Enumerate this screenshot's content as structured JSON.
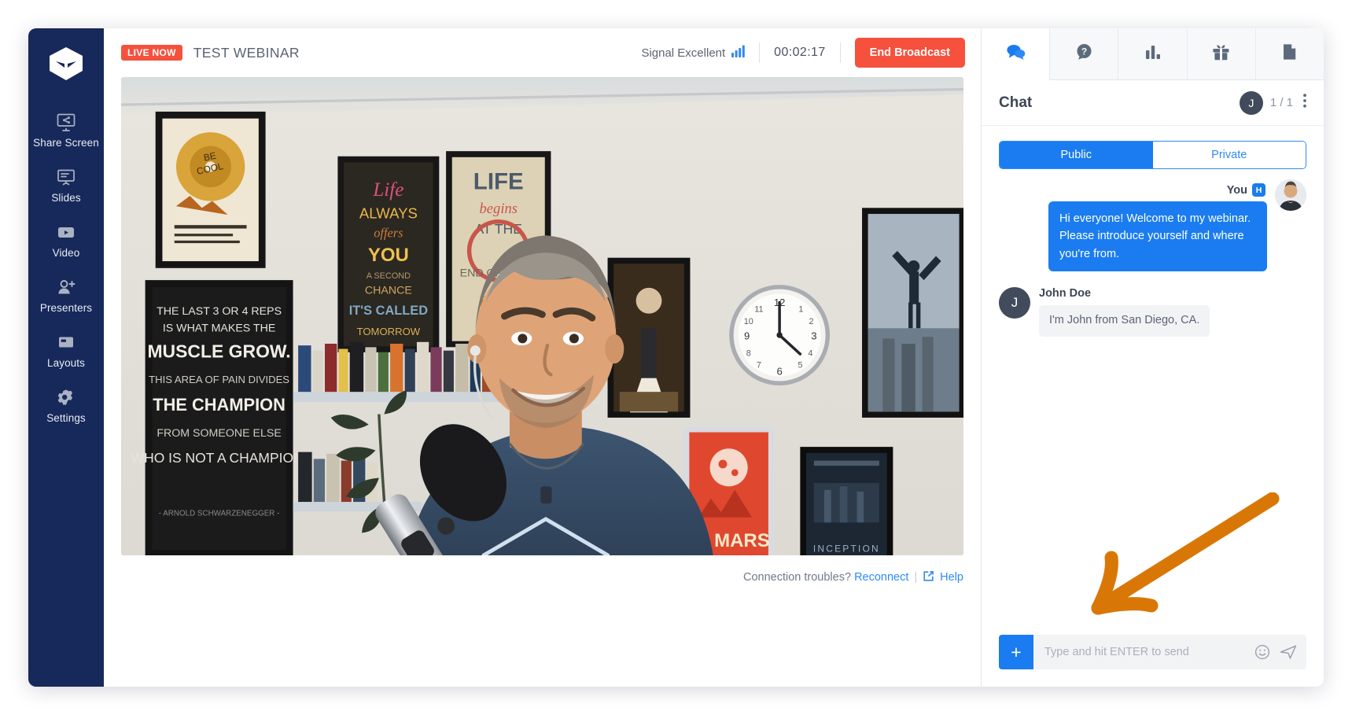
{
  "sidebar": {
    "logo_name": "webinarninja-logo",
    "items": [
      {
        "label": "Share Screen",
        "icon": "share-screen-icon"
      },
      {
        "label": "Slides",
        "icon": "slides-icon"
      },
      {
        "label": "Video",
        "icon": "video-icon"
      },
      {
        "label": "Presenters",
        "icon": "presenters-icon"
      },
      {
        "label": "Layouts",
        "icon": "layouts-icon"
      },
      {
        "label": "Settings",
        "icon": "settings-icon"
      }
    ]
  },
  "header": {
    "live_badge": "LIVE NOW",
    "title": "TEST WEBINAR",
    "signal_label": "Signal Excellent",
    "signal_icon": "signal-bars-icon",
    "timer": "00:02:17",
    "end_broadcast_label": "End Broadcast",
    "live_color": "#f5513d"
  },
  "stage": {
    "connection": {
      "prompt": "Connection troubles?",
      "reconnect_label": "Reconnect",
      "separator": "|",
      "help_label": "Help",
      "external_icon": "external-link-icon"
    }
  },
  "panel": {
    "tabs": [
      {
        "name": "chat",
        "icon": "chat-bubble-icon",
        "active": true
      },
      {
        "name": "questions",
        "icon": "question-bubble-icon",
        "active": false
      },
      {
        "name": "polls",
        "icon": "bar-chart-icon",
        "active": false
      },
      {
        "name": "offers",
        "icon": "gift-icon",
        "active": false
      },
      {
        "name": "handouts",
        "icon": "file-icon",
        "active": false
      }
    ],
    "chat_title": "Chat",
    "viewer_avatar_initial": "J",
    "viewer_count": "1 / 1",
    "menu_icon": "kebab-menu-icon",
    "visibility": {
      "public_label": "Public",
      "private_label": "Private",
      "selected": "Public"
    },
    "messages": [
      {
        "type": "outgoing",
        "author": "You",
        "badge": "H",
        "text": "Hi everyone! Welcome to my webinar. Please introduce yourself and where you're from.",
        "avatar": "host-photo-avatar"
      },
      {
        "type": "incoming",
        "author": "John Doe",
        "initial": "J",
        "text": "I'm John from San Diego, CA."
      }
    ],
    "composer": {
      "attach_label": "+",
      "placeholder": "Type and hit ENTER to send",
      "input_value": "",
      "emoji_icon": "emoji-smiley-icon",
      "send_icon": "send-arrow-icon"
    }
  },
  "annotation": {
    "name": "orange-arrow-annotation",
    "color": "#d97706",
    "points_to": "message-input"
  },
  "colors": {
    "sidebar_bg": "#17295a",
    "accent_blue": "#1a7cf0",
    "link_blue": "#2f89f5",
    "danger_red": "#f5513d",
    "text_dark": "#3d4655",
    "text_muted": "#707a8b"
  }
}
